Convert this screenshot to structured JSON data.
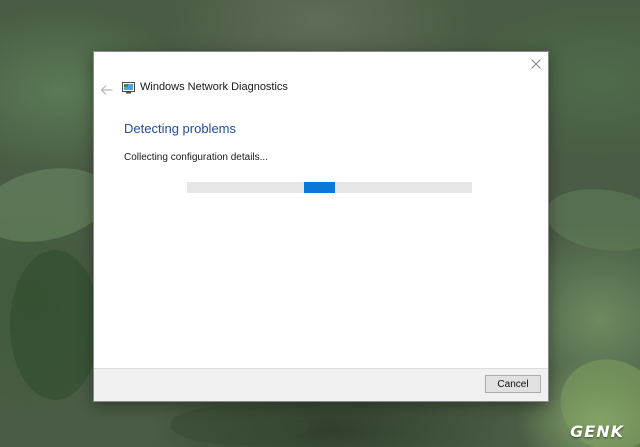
{
  "window": {
    "title": "Windows Network Diagnostics",
    "heading": "Detecting problems",
    "status": "Collecting configuration details...",
    "progress": {
      "style": "indeterminate",
      "indicator_start_fraction": 0.41,
      "indicator_width_fraction": 0.11
    },
    "cancel_label": "Cancel"
  },
  "icons": {
    "close": "close-icon",
    "back": "back-arrow-icon",
    "app": "network-diagnostics-icon"
  },
  "colors": {
    "heading": "#1f4e9a",
    "progress_fill": "#0b78d7",
    "progress_track": "#e6e6e6",
    "footer": "#f0f0f0"
  },
  "watermark": {
    "text": "GENK"
  }
}
